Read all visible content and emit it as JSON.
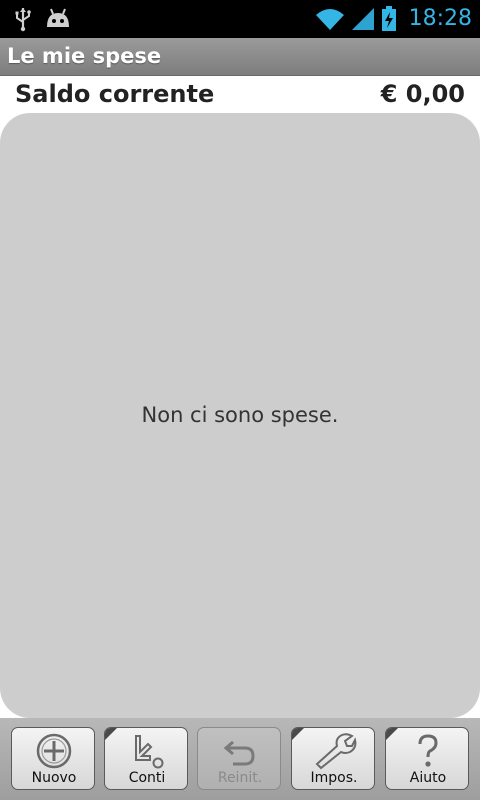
{
  "status_bar": {
    "time": "18:28",
    "left_icons": [
      "usb-icon",
      "android-debug-icon"
    ],
    "right_icons": [
      "wifi-icon",
      "signal-icon",
      "battery-charging-icon"
    ],
    "accent_color": "#33b5e5"
  },
  "title_bar": {
    "title": "Le mie spese"
  },
  "balance": {
    "label": "Saldo corrente",
    "amount": "€ 0,00"
  },
  "list": {
    "empty_message": "Non ci sono spese."
  },
  "toolbar": {
    "buttons": [
      {
        "label": "Nuovo",
        "icon": "add-circle-icon",
        "enabled": true
      },
      {
        "label": "Conti",
        "icon": "accounts-icon",
        "enabled": true
      },
      {
        "label": "Reinit.",
        "icon": "undo-icon",
        "enabled": false
      },
      {
        "label": "Impos.",
        "icon": "wrench-icon",
        "enabled": true
      },
      {
        "label": "Aiuto",
        "icon": "help-icon",
        "enabled": true
      }
    ]
  }
}
